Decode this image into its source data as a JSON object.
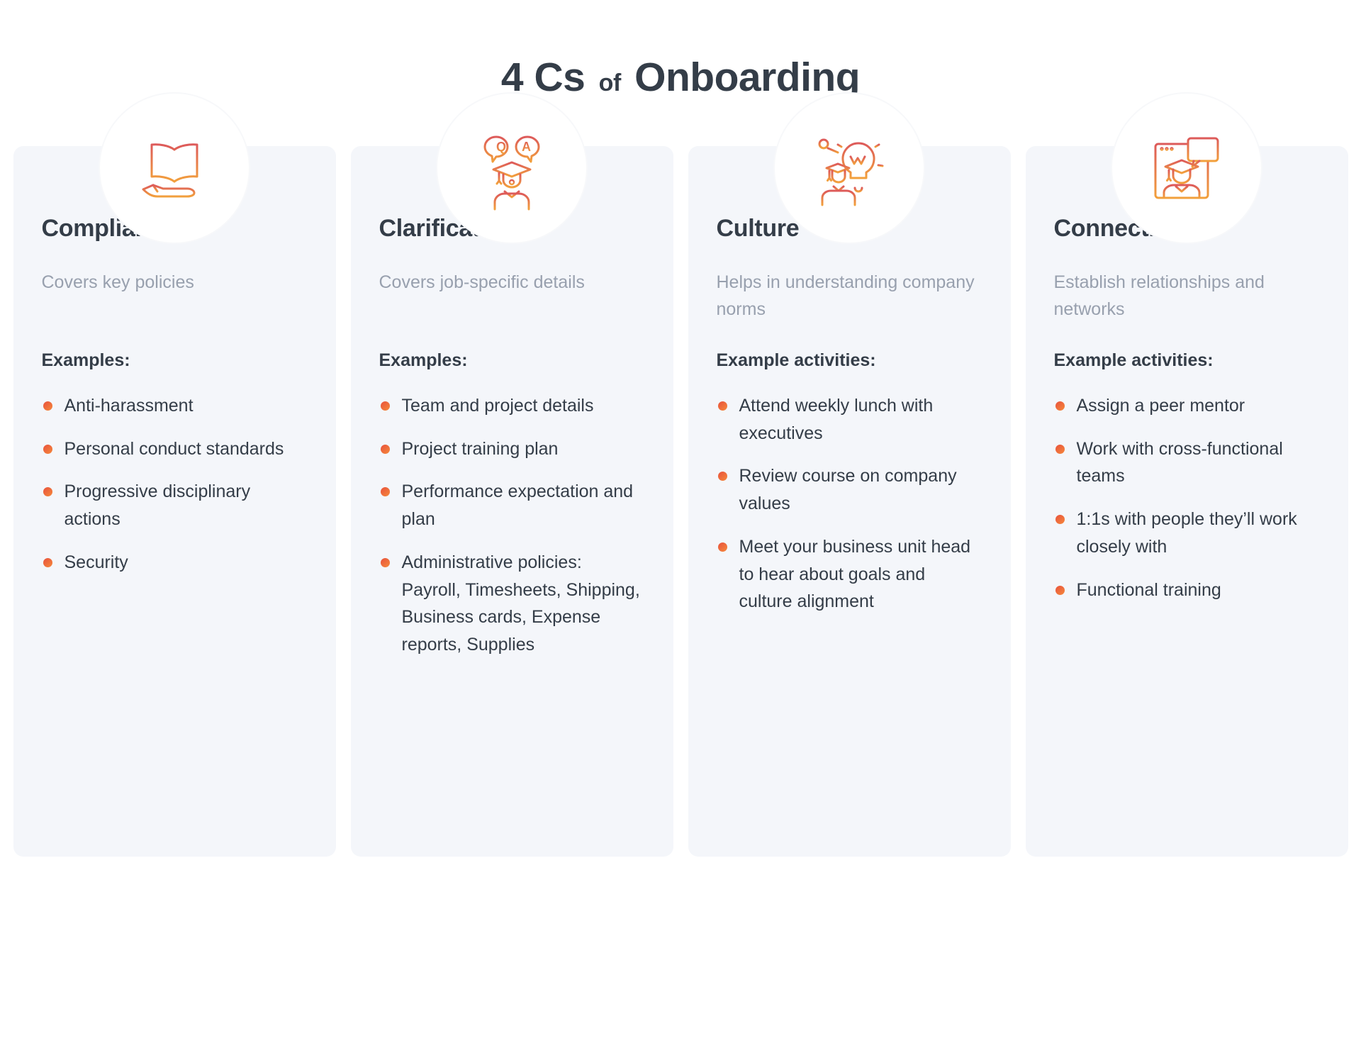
{
  "title": {
    "main_before": "4 Cs",
    "small": "of",
    "main_after": "Onboarding"
  },
  "theme": {
    "background": "#ffffff",
    "card_background": "#f4f6fa",
    "heading_color": "#343d48",
    "muted_color": "#98a0ae",
    "accent_start": "#e8513c",
    "accent_end": "#f5893b"
  },
  "cards": [
    {
      "icon_name": "open-book-on-hand-icon",
      "title": "Compliance",
      "subtitle": "Covers key policies",
      "examples_label": "Examples:",
      "items": [
        "Anti-harassment",
        "Personal conduct standards",
        "Progressive disciplinary actions",
        "Security"
      ]
    },
    {
      "icon_name": "question-answer-graduate-icon",
      "title": "Clarification",
      "subtitle": "Covers  job-specific details",
      "examples_label": "Examples:",
      "items": [
        "Team and project details",
        "Project training plan",
        "Performance expectation and plan",
        "Administrative policies:"
      ],
      "item_continuation": "Payroll, Timesheets, Shipping, Business cards, Expense reports, Supplies"
    },
    {
      "icon_name": "lightbulb-graduate-idea-icon",
      "title": "Culture",
      "subtitle": "Helps in understanding company norms",
      "examples_label": "Example activities:",
      "items": [
        "Attend weekly lunch with executives",
        "Review course on company values",
        "Meet your business unit head to hear about goals and culture alignment"
      ]
    },
    {
      "icon_name": "browser-window-graduate-chat-icon",
      "title": "Connection",
      "subtitle": "Establish relationships and networks",
      "examples_label": "Example activities:",
      "items": [
        "Assign a peer mentor",
        "Work with cross-functional teams",
        "1:1s with people they’ll work closely with",
        "Functional training"
      ]
    }
  ]
}
